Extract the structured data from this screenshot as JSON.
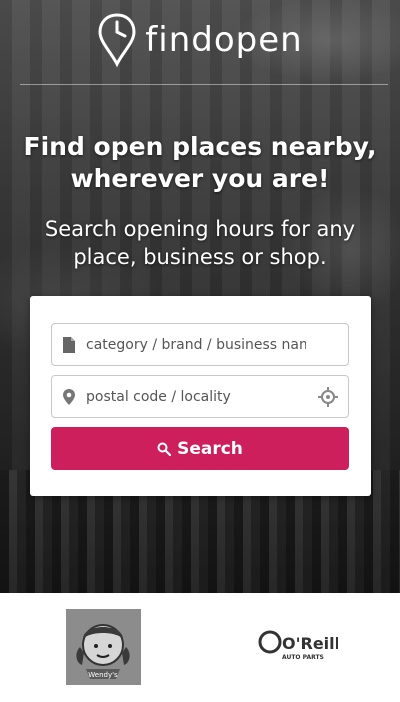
{
  "app": {
    "name": "findopen"
  },
  "hero": {
    "headline_line1": "Find open places nearby,",
    "headline_line2": "wherever you are!",
    "subline_line1": "Search opening hours for any",
    "subline_line2": "place, business or shop."
  },
  "search": {
    "category_placeholder": "category / brand / business name",
    "location_placeholder": "postal code / locality",
    "button_label": "Search"
  },
  "brands": {
    "oreilly_main": "O'Reilly",
    "oreilly_sub": "AUTO PARTS",
    "wendys_label": "Wendy's"
  },
  "colors": {
    "accent": "#cc1f5c",
    "text_on_hero": "#ffffff"
  }
}
